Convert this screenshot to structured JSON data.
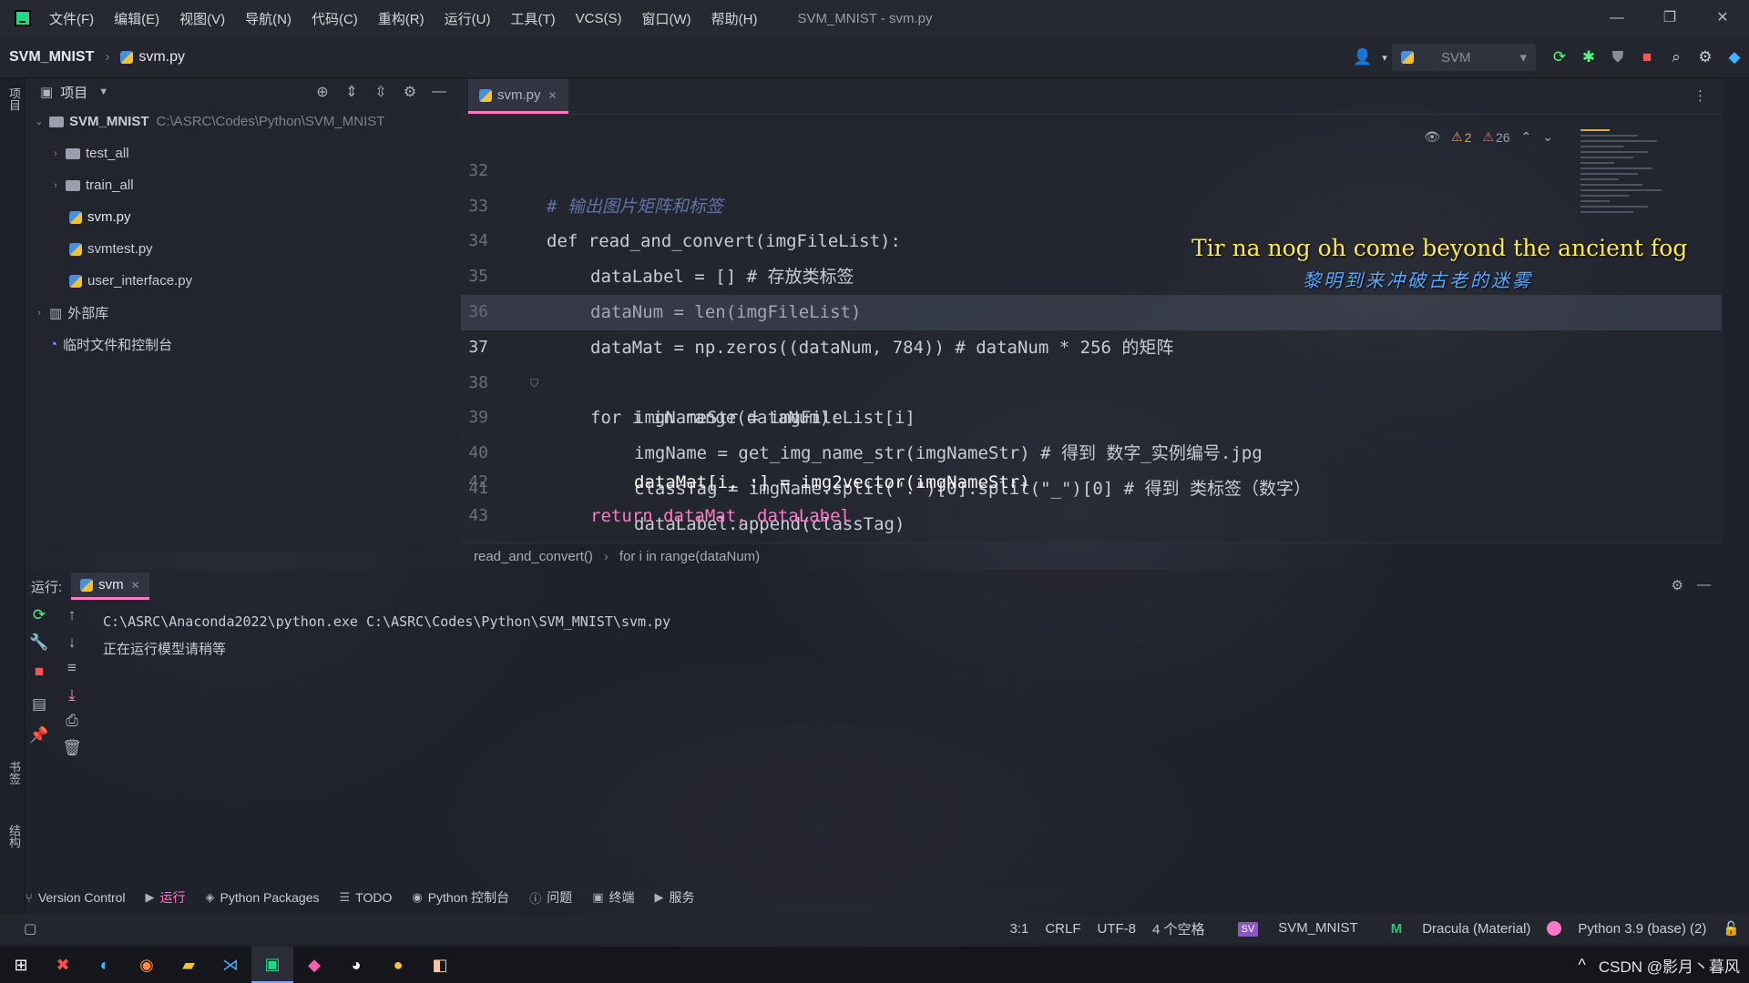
{
  "titlebar": {
    "menus": [
      "文件(F)",
      "编辑(E)",
      "视图(V)",
      "导航(N)",
      "代码(C)",
      "重构(R)",
      "运行(U)",
      "工具(T)",
      "VCS(S)",
      "窗口(W)",
      "帮助(H)"
    ],
    "title": "SVM_MNIST - svm.py",
    "controls": [
      "—",
      "❐",
      "✕"
    ]
  },
  "navbar": {
    "project": "SVM_MNIST",
    "file": "svm.py",
    "run_config": "SVM"
  },
  "left_strip": {
    "project_tab": "项目",
    "bookmarks_tab": "书签",
    "structure_tab": "结构"
  },
  "project_panel": {
    "title": "项目",
    "tree": [
      {
        "name": "SVM_MNIST",
        "path": "C:\\ASRC\\Codes\\Python\\SVM_MNIST",
        "type": "root"
      },
      {
        "name": "test_all",
        "type": "folder"
      },
      {
        "name": "train_all",
        "type": "folder"
      },
      {
        "name": "svm.py",
        "type": "py"
      },
      {
        "name": "svmtest.py",
        "type": "py"
      },
      {
        "name": "user_interface.py",
        "type": "py"
      },
      {
        "name": "外部库",
        "type": "lib"
      },
      {
        "name": "临时文件和控制台",
        "type": "scratch"
      }
    ]
  },
  "editor": {
    "tab": "svm.py",
    "warnings": "2",
    "weak_warnings": "26",
    "lines": [
      {
        "n": "32",
        "text": "# 输出图片矩阵和标签"
      },
      {
        "n": "33",
        "text": "def read_and_convert(imgFileList):"
      },
      {
        "n": "34",
        "text": "dataLabel = [] # 存放类标签"
      },
      {
        "n": "35",
        "text": "dataNum = len(imgFileList)"
      },
      {
        "n": "36",
        "text": "dataMat = np.zeros((dataNum, 784)) # dataNum * 256 的矩阵"
      },
      {
        "n": "37",
        "text": "for i in range(dataNum):"
      },
      {
        "n": "38",
        "text": "imgNameStr = imgFileList[i]"
      },
      {
        "n": "39",
        "text": "imgName = get_img_name_str(imgNameStr) # 得到 数字_实例编号.jpg"
      },
      {
        "n": "40",
        "text": "classTag = imgName.split(\".\")[0].split(\"_\")[0] # 得到 类标签（数字）"
      },
      {
        "n": "41",
        "text": "dataLabel.append(classTag)"
      },
      {
        "n": "42",
        "text": "dataMat[i, :] = img2vector(imgNameStr)"
      },
      {
        "n": "43",
        "text": "return dataMat, dataLabel"
      }
    ],
    "lyric_en": "Tir na nog oh come beyond the ancient fog",
    "lyric_zh": "黎明到来冲破古老的迷雾",
    "breadcrumb": [
      "read_and_convert()",
      "for i in range(dataNum)"
    ]
  },
  "run_panel": {
    "label": "运行:",
    "tab": "svm",
    "console": [
      "C:\\ASRC\\Anaconda2022\\python.exe C:\\ASRC\\Codes\\Python\\SVM_MNIST\\svm.py",
      "正在运行模型请稍等"
    ]
  },
  "tool_windows": [
    "Version Control",
    "运行",
    "Python Packages",
    "TODO",
    "Python 控制台",
    "问题",
    "终端",
    "服务"
  ],
  "statusbar": {
    "position": "3:1",
    "line_sep": "CRLF",
    "encoding": "UTF-8",
    "indent": "4 个空格",
    "project_badge": "SV",
    "project": "SVM_MNIST",
    "theme": "Dracula (Material)",
    "interpreter": "Python 3.9 (base) (2)"
  },
  "taskbar": {
    "tray_text": "CSDN @影月丶暮风"
  }
}
